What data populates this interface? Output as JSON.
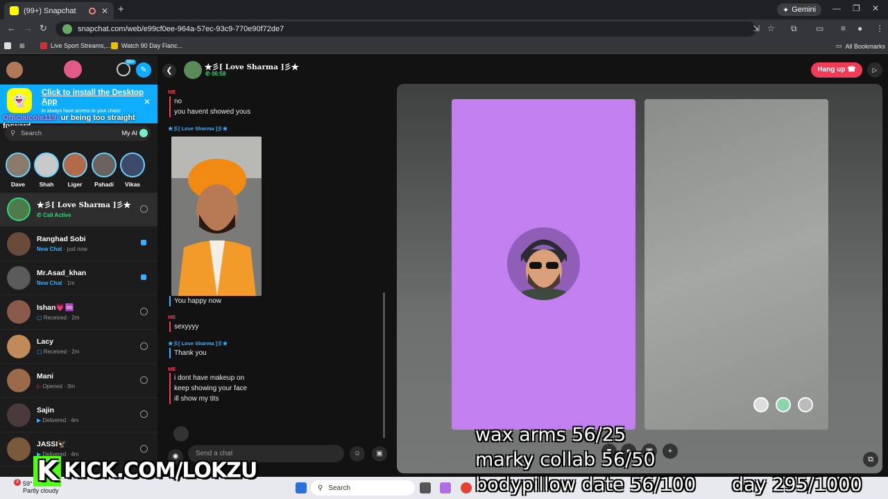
{
  "browser": {
    "tab_title": "(99+) Snapchat",
    "new_tab": "+",
    "gemini_label": "Gemini",
    "url": "snapchat.com/web/e99cf0ee-964a-57ec-93c9-770e90f72de7",
    "bookmarks": [
      "Live Sport Streams,...",
      "Watch 90 Day Fianc..."
    ],
    "all_bookmarks": "All Bookmarks"
  },
  "sidebar": {
    "add_friends_badge": "99+",
    "banner": {
      "title": "Click to install the Desktop App",
      "subtitle": "to always have access to your chats!"
    },
    "search_placeholder": "Search",
    "my_ai": "My AI",
    "stories": [
      "Dave",
      "Shah",
      "Liger",
      "Pahadi",
      "Vikas"
    ],
    "chats": [
      {
        "name": "★彡[ Love Sharma ]彡★",
        "status": "Call Active",
        "time": ""
      },
      {
        "name": "Ranghad Sobi",
        "status": "New Chat",
        "time": "just now"
      },
      {
        "name": "Mr.Asad_khan",
        "status": "New Chat",
        "time": "1m"
      },
      {
        "name": "Ishan💗♾️",
        "status": "Received",
        "time": "2m"
      },
      {
        "name": "Lacy",
        "status": "Received",
        "time": "2m"
      },
      {
        "name": "Mani",
        "status": "Opened",
        "time": "3m"
      },
      {
        "name": "Sajin",
        "status": "Delivered",
        "time": "4m"
      },
      {
        "name": "JASSI🦅",
        "status": "Delivered",
        "time": "4m"
      }
    ]
  },
  "overlay_comment": {
    "user": "Officialcole119:",
    "text": " ur being too straight forward"
  },
  "chat": {
    "contact": "★彡[ Love Sharma ]彡★",
    "call_time": "00:58",
    "me_label": "ME",
    "them_label": "★彡[ Love Sharma ]彡★",
    "messages": {
      "m1_a": "no",
      "m1_b": "you havent showed yous",
      "m2": "You happy now",
      "m3": "sexyyyy",
      "m4": "Thank you",
      "m5_a": "i dont have makeup on",
      "m5_b": "keep showing your  face",
      "m5_c": "ill show my tits"
    },
    "input_placeholder": "Send a chat"
  },
  "call": {
    "hang_up": "Hang up"
  },
  "stream_overlay": {
    "goal1": "wax arms 56/25",
    "goal2": "marky collab 56/50",
    "goal3": "bodypillow date 56/100",
    "day": "day 295/1000",
    "kick": "KICK.COM/LOKZU",
    "kick_logo": "K"
  },
  "taskbar": {
    "search": "Search",
    "temp": "59°",
    "weather": "Partly cloudy",
    "notif": "3"
  },
  "colors": {
    "snap_yellow": "#fffc00",
    "snap_red": "#f23c57",
    "snap_blue": "#0fadff",
    "call_purple": "#c17ff0"
  }
}
